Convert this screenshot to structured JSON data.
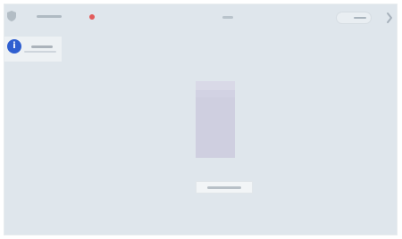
{
  "window": {
    "toolbar": {
      "left_button_icon": "shield-icon",
      "status_dot_color": "#e25b5b",
      "right_icon": "chevron-right-icon"
    },
    "left_panel": {
      "info_icon": "info-icon"
    },
    "main": {
      "card_colors": {
        "primary": "#cfcfe0",
        "header": "#d9d9e7"
      }
    }
  }
}
